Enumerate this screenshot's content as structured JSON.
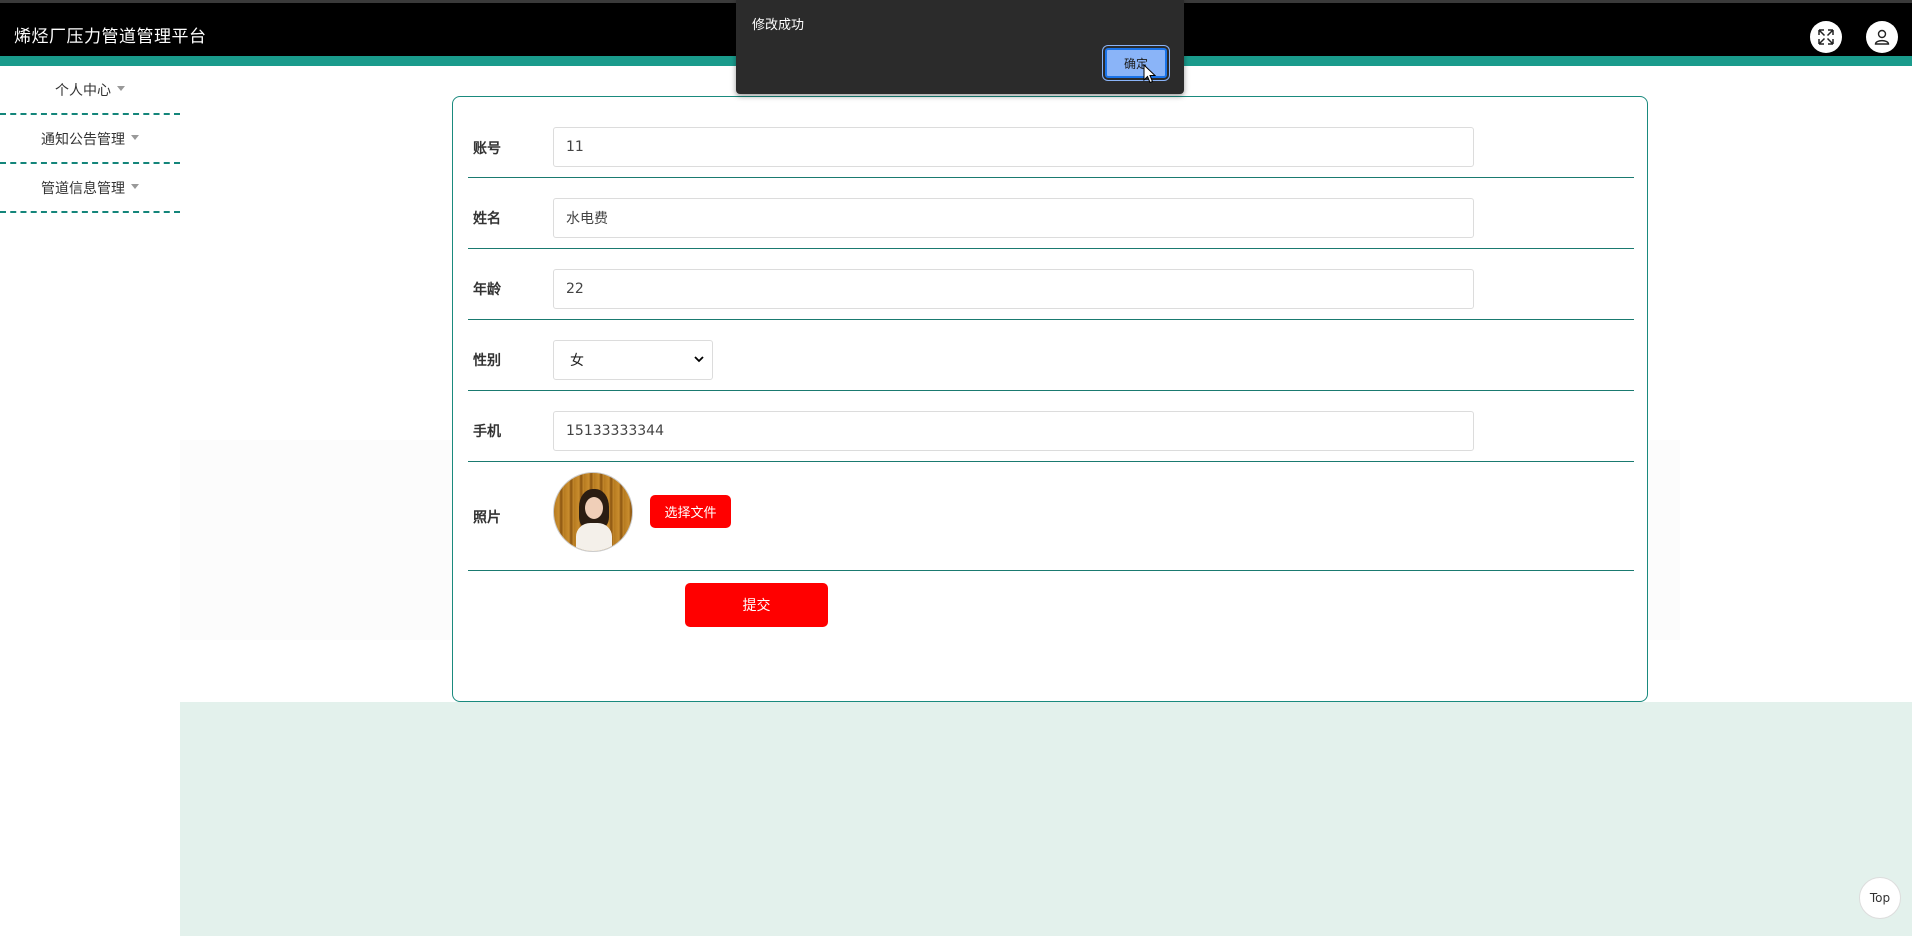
{
  "app": {
    "title": "烯烃厂压力管道管理平台"
  },
  "header": {
    "fullscreen_icon": "expand-icon",
    "user_icon": "user-icon"
  },
  "sidebar": {
    "items": [
      {
        "label": "个人中心"
      },
      {
        "label": "通知公告管理"
      },
      {
        "label": "管道信息管理"
      }
    ]
  },
  "form": {
    "account": {
      "label": "账号",
      "value": "11"
    },
    "name": {
      "label": "姓名",
      "value": "水电费"
    },
    "age": {
      "label": "年龄",
      "value": "22"
    },
    "gender": {
      "label": "性别",
      "value": "女"
    },
    "phone": {
      "label": "手机",
      "value": "15133333344"
    },
    "photo": {
      "label": "照片",
      "file_button": "选择文件"
    },
    "submit_label": "提交"
  },
  "dialog": {
    "message": "修改成功",
    "ok_label": "确定"
  },
  "back_to_top": {
    "label": "Top"
  },
  "colors": {
    "accent": "#1a9b8c",
    "primary_button": "#ff0000",
    "header_bg": "#000000",
    "content_bg": "#e3f1ec"
  }
}
